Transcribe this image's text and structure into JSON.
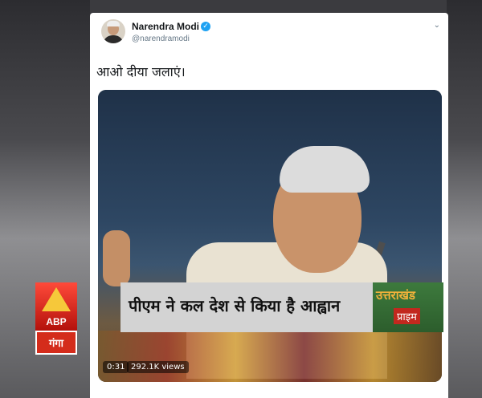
{
  "tweet": {
    "display_name": "Narendra Modi",
    "handle": "@narendramodi",
    "text": "आओ दीया जलाएं।",
    "verified_icon": "verified-badge-icon",
    "menu_icon": "chevron-down-icon"
  },
  "video": {
    "duration": "0:31",
    "views": "292.1K views"
  },
  "overlay": {
    "channel_logo": {
      "top": "ABP",
      "bottom": "गंगा"
    },
    "headline": "पीएम ने कल देश से किया है आह्वान",
    "show_logo": {
      "line1": "उत्तराखंड",
      "line2": "प्राइम"
    }
  },
  "colors": {
    "tweet_bg": "#ffffff",
    "verified": "#1da1f2",
    "abp_red": "#d42c1b",
    "strip_gray": "#d3d3d3"
  }
}
